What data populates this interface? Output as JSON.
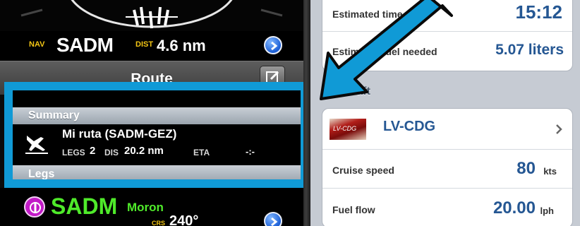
{
  "nav": {
    "label": "NAV",
    "waypoint": "SADM",
    "dist_label": "DIST",
    "distance": "4.6 nm"
  },
  "route": {
    "title": "Route",
    "summary_header": "Summary",
    "name": "Mi ruta (SADM-GEZ)",
    "legs_label": "LEGS",
    "legs_value": "2",
    "dis_label": "DIS",
    "dis_value": "20.2 nm",
    "eta_label": "ETA",
    "eta_value": "-:-",
    "legs_header": "Legs"
  },
  "waypoint_row": {
    "code": "SADM",
    "name": "Moron",
    "course_label": "CRS",
    "course": "240°"
  },
  "trip": {
    "estimated_time_label": "Estimated time",
    "estimated_time": "15:12",
    "fuel_label": "Estimated fuel needed",
    "fuel_value": "5.07 liters"
  },
  "aircraft": {
    "section_header": "Aircraft",
    "photo_caption": "LV-CDG",
    "registration": "LV-CDG",
    "cruise_speed_label": "Cruise speed",
    "cruise_speed": "80",
    "cruise_speed_unit": "kts",
    "fuel_flow_label": "Fuel flow",
    "fuel_flow": "20.00",
    "fuel_flow_unit": "lph"
  },
  "colors": {
    "highlight": "#109ad6",
    "nav_tag": "#f2c514",
    "waypoint_green": "#4fea2a",
    "value_blue": "#255793",
    "waypoint_magenta": "#c21ac7"
  },
  "icons": [
    "chevron-right-icon",
    "edit-icon",
    "plane-landing-icon",
    "vor-waypoint-icon",
    "direction-arrow-icon"
  ]
}
